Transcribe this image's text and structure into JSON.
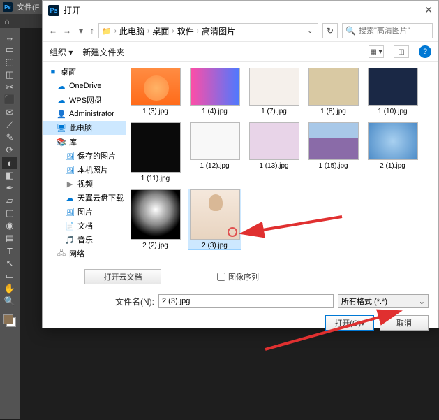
{
  "ps": {
    "logo": "Ps",
    "menu_file": "文件(F",
    "tools": [
      "↔",
      "▭",
      "⬚",
      "◫",
      "✂",
      "⬛",
      "✉",
      "⟋",
      "✎",
      "⟳",
      "◐",
      "◧",
      "✒",
      "▱",
      "▢",
      "◉",
      "▤",
      "T",
      "↖",
      "▭",
      "✋",
      "🔍"
    ]
  },
  "dialog": {
    "title": "打开",
    "path": {
      "crumbs": [
        "此电脑",
        "桌面",
        "软件",
        "高清图片"
      ]
    },
    "search_placeholder": "搜索\"高清图片\"",
    "toolbar": {
      "organize": "组织",
      "new_folder": "新建文件夹",
      "help": "?"
    },
    "tree": [
      {
        "icon": "■",
        "color": "blue",
        "label": "桌面",
        "indent": 0
      },
      {
        "icon": "☁",
        "color": "blue",
        "label": "OneDrive",
        "indent": 1
      },
      {
        "icon": "☁",
        "color": "blue",
        "label": "WPS网盘",
        "indent": 1
      },
      {
        "icon": "👤",
        "color": "gray",
        "label": "Administrator",
        "indent": 1
      },
      {
        "icon": "🖥",
        "color": "blue",
        "label": "此电脑",
        "indent": 1,
        "selected": true
      },
      {
        "icon": "📚",
        "color": "green",
        "label": "库",
        "indent": 1
      },
      {
        "icon": "🖼",
        "color": "blue",
        "label": "保存的图片",
        "indent": 2
      },
      {
        "icon": "🖼",
        "color": "blue",
        "label": "本机照片",
        "indent": 2
      },
      {
        "icon": "▶",
        "color": "gray",
        "label": "视频",
        "indent": 2
      },
      {
        "icon": "☁",
        "color": "blue",
        "label": "天翼云盘下载",
        "indent": 2
      },
      {
        "icon": "🖼",
        "color": "blue",
        "label": "图片",
        "indent": 2
      },
      {
        "icon": "📄",
        "color": "yellow",
        "label": "文档",
        "indent": 2
      },
      {
        "icon": "🎵",
        "color": "blue",
        "label": "音乐",
        "indent": 2
      },
      {
        "icon": "🖧",
        "color": "gray",
        "label": "网络",
        "indent": 1
      }
    ],
    "files": [
      {
        "label": "1 (3).jpg",
        "thumb": "t-orange"
      },
      {
        "label": "1 (4).jpg",
        "thumb": "t-pink"
      },
      {
        "label": "1 (7).jpg",
        "thumb": "t-family"
      },
      {
        "label": "1 (8).jpg",
        "thumb": "t-beige"
      },
      {
        "label": "1 (10).jpg",
        "thumb": "t-navy"
      },
      {
        "label": "1 (11).jpg",
        "thumb": "t-black",
        "tall": true
      },
      {
        "label": "1 (12).jpg",
        "thumb": "t-white"
      },
      {
        "label": "1 (13).jpg",
        "thumb": "t-flower"
      },
      {
        "label": "1 (15).jpg",
        "thumb": "t-train"
      },
      {
        "label": "2 (1).jpg",
        "thumb": "t-bluerose"
      },
      {
        "label": "2 (2).jpg",
        "thumb": "t-smoke",
        "tall": true
      },
      {
        "label": "2 (3).jpg",
        "thumb": "t-portrait",
        "tall": true,
        "selected": true,
        "ring": true
      }
    ],
    "open_cloud": "打开云文档",
    "image_sequence": "图像序列",
    "filename_label": "文件名(N):",
    "filename_value": "2 (3).jpg",
    "filetype": "所有格式 (*.*)",
    "open_btn": "打开(O)",
    "cancel_btn": "取消"
  }
}
